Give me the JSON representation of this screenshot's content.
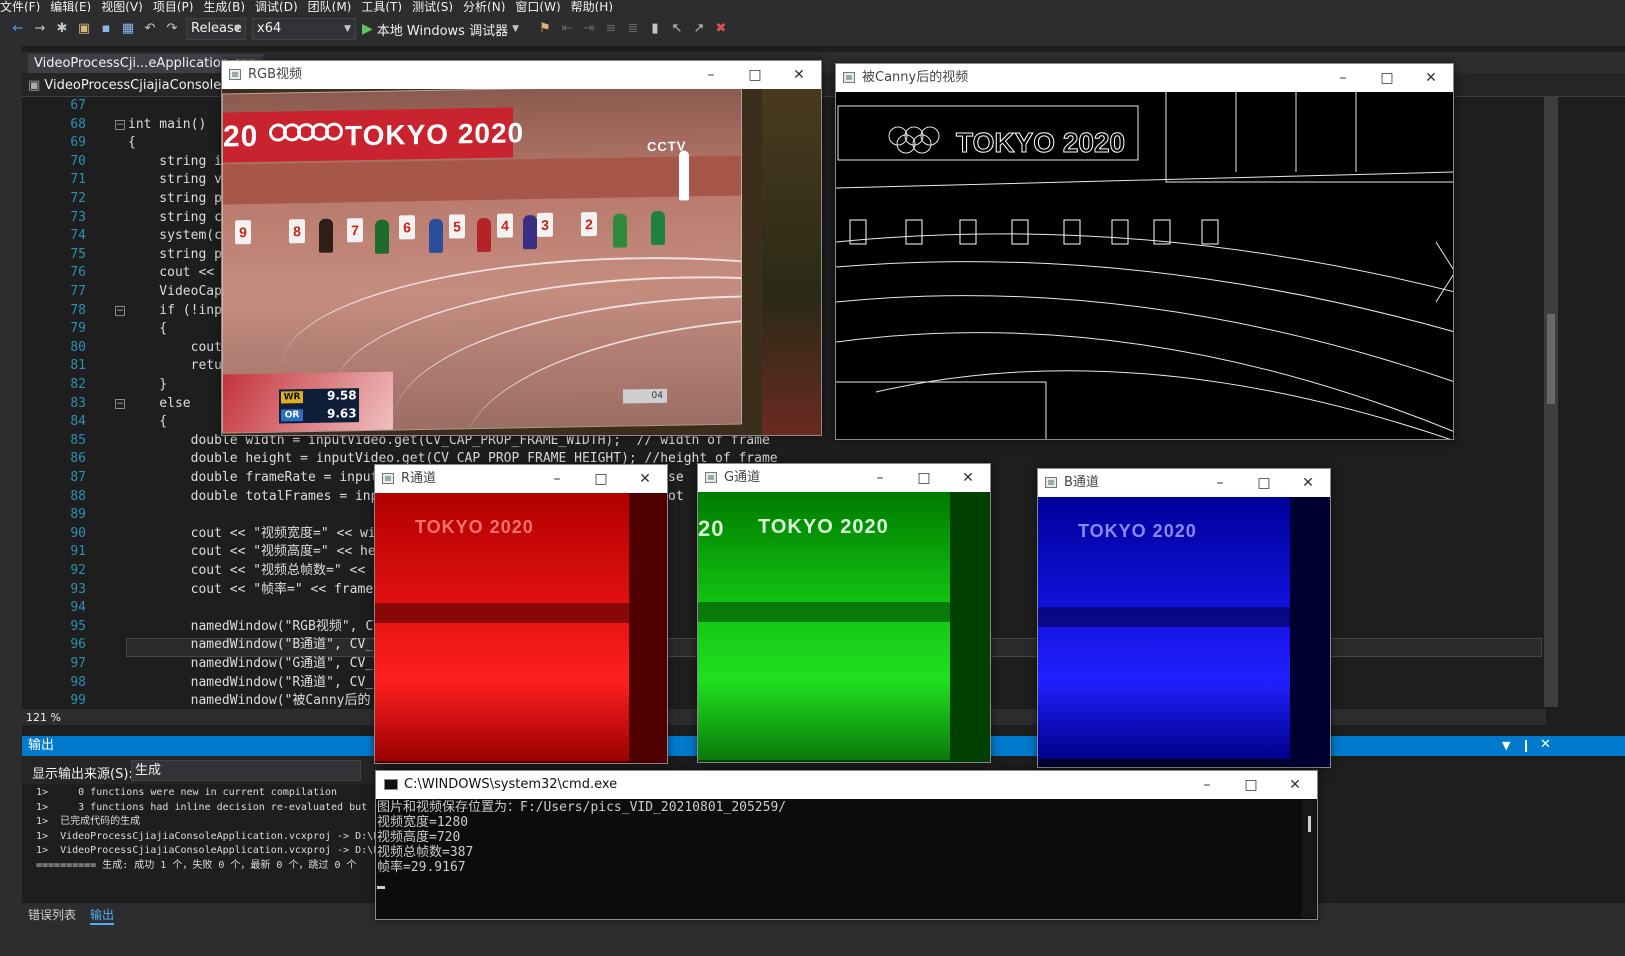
{
  "menu": [
    "文件(F)",
    "编辑(E)",
    "视图(V)",
    "项目(P)",
    "生成(B)",
    "调试(D)",
    "团队(M)",
    "工具(T)",
    "测试(S)",
    "分析(N)",
    "窗口(W)",
    "帮助(H)"
  ],
  "toolbar": {
    "config": "Release",
    "platform": "x64",
    "run_label": "本地 Windows 调试器"
  },
  "editor": {
    "doc_tab": "VideoProcessCji...eApplication.cpp",
    "nav_project": "VideoProcessCjiajiaConsoleApp",
    "zoom": "121 %",
    "lines": [
      {
        "n": "67",
        "t": ""
      },
      {
        "n": "68",
        "t": "int main()"
      },
      {
        "n": "69",
        "t": "{"
      },
      {
        "n": "70",
        "t": "    string i"
      },
      {
        "n": "71",
        "t": "    string v"
      },
      {
        "n": "72",
        "t": "    string p"
      },
      {
        "n": "73",
        "t": "    string c"
      },
      {
        "n": "74",
        "t": "    system(c"
      },
      {
        "n": "75",
        "t": "    string p"
      },
      {
        "n": "76",
        "t": "    cout << "
      },
      {
        "n": "77",
        "t": "    VideoCap"
      },
      {
        "n": "78",
        "t": "    if (!inp"
      },
      {
        "n": "79",
        "t": "    {"
      },
      {
        "n": "80",
        "t": "        cout"
      },
      {
        "n": "81",
        "t": "        retu"
      },
      {
        "n": "82",
        "t": "    }"
      },
      {
        "n": "83",
        "t": "    else"
      },
      {
        "n": "84",
        "t": "    {"
      },
      {
        "n": "85",
        "t": "        double width = inputVideo.get(CV_CAP_PROP_FRAME_WIDTH);  // width of frame"
      },
      {
        "n": "86",
        "t": "        double height = inputVideo.get(CV_CAP_PROP_FRAME_HEIGHT); //height of frame"
      },
      {
        "n": "87",
        "t": "        double frameRate = input                                   r se"
      },
      {
        "n": "88",
        "t": "        double totalFrames = inpu                                  /tot"
      },
      {
        "n": "89",
        "t": ""
      },
      {
        "n": "90",
        "t": "        cout << \"视频宽度=\" << wi"
      },
      {
        "n": "91",
        "t": "        cout << \"视频高度=\" << he"
      },
      {
        "n": "92",
        "t": "        cout << \"视频总帧数=\" <<"
      },
      {
        "n": "93",
        "t": "        cout << \"帧率=\" << frame"
      },
      {
        "n": "94",
        "t": ""
      },
      {
        "n": "95",
        "t": "        namedWindow(\"RGB视频\", CV"
      },
      {
        "n": "96",
        "t": "        namedWindow(\"B通道\", CV_V"
      },
      {
        "n": "97",
        "t": "        namedWindow(\"G通道\", CV_V"
      },
      {
        "n": "98",
        "t": "        namedWindow(\"R通道\", CV_V"
      },
      {
        "n": "99",
        "t": "        namedWindow(\"被Canny后的"
      }
    ]
  },
  "output": {
    "header": "输出",
    "source_label": "显示输出来源(S):",
    "source_value": "生成",
    "lines": [
      "1>     0 functions were new in current compilation",
      "1>     3 functions had inline decision re-evaluated but rem",
      "1>  已完成代码的生成",
      "1>  VideoProcessCjiajiaConsoleApplication.vcxproj -> D:\\Pr",
      "1>  VideoProcessCjiajiaConsoleApplication.vcxproj -> D:\\Pr",
      "========== 生成: 成功 1 个，失败 0 个，最新 0 个，跳过 0 个"
    ]
  },
  "bottom_tabs": [
    "错误列表",
    "输出"
  ],
  "windows": {
    "rgb": {
      "title": "RGB视频"
    },
    "canny": {
      "title": "被Canny后的视频"
    },
    "r": {
      "title": "R通道"
    },
    "g": {
      "title": "G通道"
    },
    "b": {
      "title": "B通道"
    },
    "cmd": {
      "title": "C:\\WINDOWS\\system32\\cmd.exe",
      "lines": [
        "图片和视频保存位置为：F:/Users/pics_VID_20210801_205259/",
        "视频宽度=1280",
        "视频高度=720",
        "视频总帧数=387",
        "帧率=29.9167"
      ]
    }
  },
  "video": {
    "board": "TOKYO 2020",
    "board_partial": "20",
    "broadcaster": "CCTV",
    "wr_label": "WR",
    "wr_value": "9.58",
    "or_label": "OR",
    "or_value": "9.63",
    "lanes": [
      "9",
      "8",
      "7",
      "6",
      "5",
      "4",
      "3",
      "2"
    ],
    "clock": "04"
  },
  "colors": {
    "accent": "#007acc",
    "menubar": "#2d2d30",
    "editor_bg": "#1e1e1e"
  }
}
